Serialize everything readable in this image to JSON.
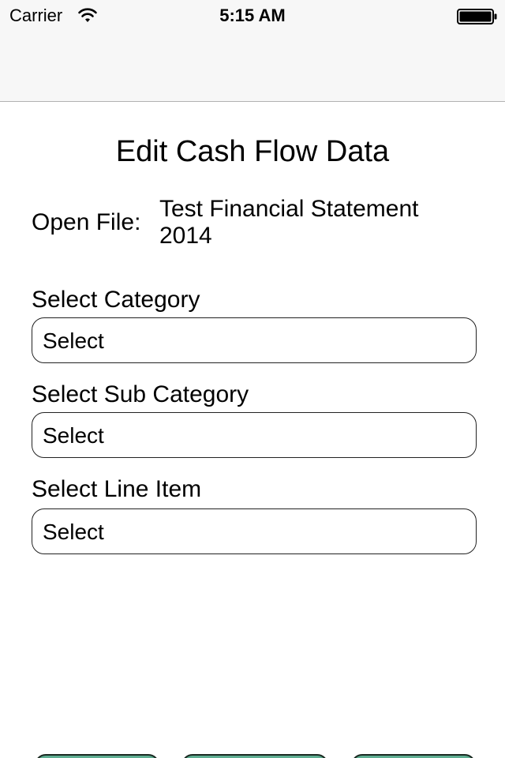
{
  "status_bar": {
    "carrier": "Carrier",
    "wifi_icon": "wifi-icon",
    "time": "5:15 AM",
    "battery_icon": "battery-icon"
  },
  "page": {
    "title": "Edit Cash Flow Data"
  },
  "open_file": {
    "label": "Open File:",
    "value": "Test Financial Statement 2014"
  },
  "fields": {
    "category": {
      "label": "Select Category",
      "value": "Select"
    },
    "sub_category": {
      "label": "Select Sub Category",
      "value": "Select"
    },
    "line_item": {
      "label": "Select Line Item",
      "value": "Select"
    }
  },
  "colors": {
    "button_fill": "#5fae92",
    "nav_background": "#f7f7f7"
  }
}
